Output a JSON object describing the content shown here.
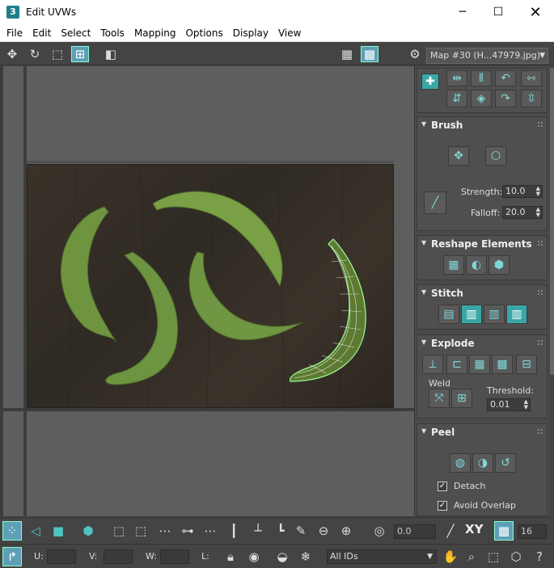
{
  "window": {
    "title": "Edit UVWs",
    "app_icon": "3",
    "min_label": "─",
    "max_label": "☐",
    "close_label": "✕"
  },
  "menu": [
    "File",
    "Edit",
    "Select",
    "Tools",
    "Mapping",
    "Options",
    "Display",
    "View"
  ],
  "toolbar": {
    "uv_label": "U V",
    "map_select": "Map #30 (H...47979.jpg)"
  },
  "brush": {
    "title": "Brush",
    "strength_label": "Strength:",
    "strength_value": "10.0",
    "falloff_label": "Falloff:",
    "falloff_value": "20.0"
  },
  "reshape": {
    "title": "Reshape Elements"
  },
  "stitch": {
    "title": "Stitch"
  },
  "explode": {
    "title": "Explode",
    "weld_label": "Weld",
    "threshold_label": "Threshold:",
    "threshold_value": "0.01"
  },
  "peel": {
    "title": "Peel",
    "detach_label": "Detach",
    "avoid_overlap_label": "Avoid Overlap",
    "detach_checked": true,
    "avoid_overlap_checked": true
  },
  "bottom": {
    "angle_value": "0.0",
    "xy_label": "XY",
    "grid_value": "16",
    "u_label": "U:",
    "v_label": "V:",
    "w_label": "W:",
    "l_label": "L:",
    "ids_select": "All IDs"
  },
  "colors": {
    "accent": "#5d9fb5",
    "teal": "#3aa7a7",
    "selection": "#9cff9c"
  }
}
